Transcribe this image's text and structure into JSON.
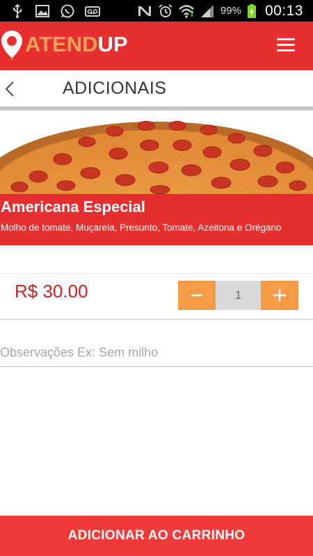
{
  "status_bar": {
    "left_icons": [
      "usb-icon",
      "image-icon",
      "whatsapp-icon",
      "voicemail-icon"
    ],
    "right_icons": [
      "nfc-mute-icon",
      "alarm-icon",
      "wifi-icon",
      "signal-icon",
      "battery-charging-icon"
    ],
    "battery_percent": "99%",
    "time": "00:13"
  },
  "app_bar": {
    "logo_part1": "ATEND",
    "logo_part2": "UP",
    "menu_icon": "hamburger-menu-icon",
    "colors": {
      "background": "#e63030",
      "logo_accent": "#f7a25a"
    }
  },
  "page": {
    "title": "ADICIONAIS",
    "back_icon": "chevron-left-icon"
  },
  "product": {
    "image": "pepperoni-pizza",
    "name": "Americana Especial",
    "description": "Molho de tomate, Muçarela, Presunto, Tomate, Azeitona e Orégano",
    "price": "R$ 30.00"
  },
  "quantity": {
    "decrement_label": "−",
    "value": "1",
    "increment_label": "+",
    "colors": {
      "buttons": "#f59a45",
      "value_bg": "#d9d9d9"
    }
  },
  "observations": {
    "placeholder": "Observações Ex: Sem milho",
    "value": ""
  },
  "cta": {
    "label": "ADICIONAR AO CARRINHO",
    "color": "#f03b3b"
  }
}
